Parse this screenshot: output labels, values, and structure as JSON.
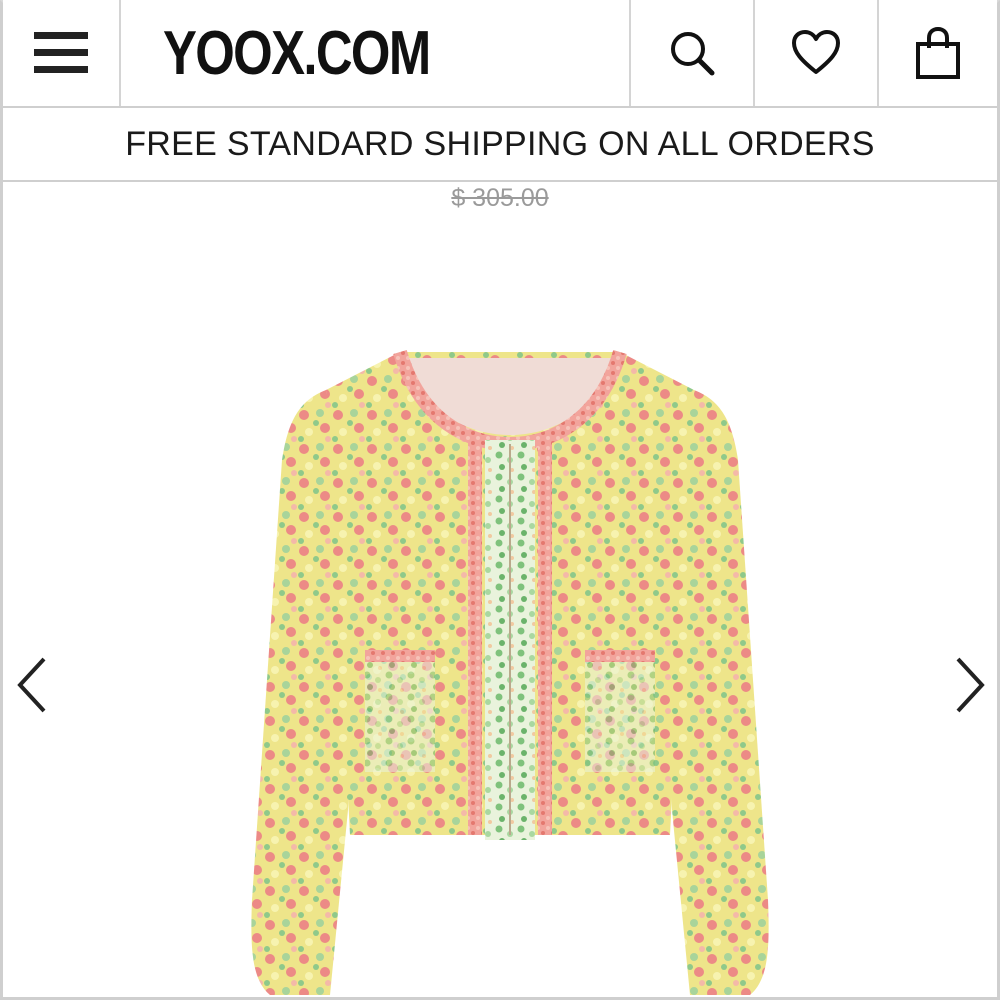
{
  "header": {
    "logo": "YOOX.COM",
    "icons": {
      "menu": "hamburger-menu-icon",
      "search": "search-icon",
      "wishlist": "heart-icon",
      "bag": "shopping-bag-icon"
    }
  },
  "banner": {
    "text": "FREE STANDARD SHIPPING ON ALL ORDERS"
  },
  "product": {
    "original_price": "$ 305.00",
    "image": "floral-print-jacket",
    "colors": {
      "yellow": "#e9e27a",
      "pink": "#ec8a86",
      "green": "#8fc98a",
      "lining": "#f0dcd6"
    }
  },
  "carousel": {
    "prev_icon": "chevron-left-icon",
    "next_icon": "chevron-right-icon"
  }
}
